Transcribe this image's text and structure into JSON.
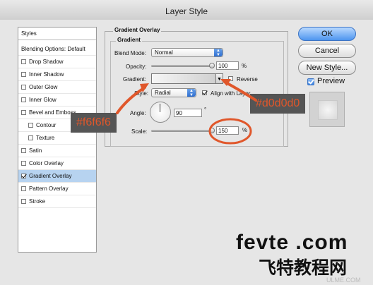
{
  "window": {
    "title": "Layer Style"
  },
  "styles_panel": {
    "items": [
      {
        "label": "Styles",
        "checkbox": false,
        "checked": false,
        "selected": false,
        "indent": 0
      },
      {
        "label": "Blending Options: Default",
        "checkbox": false,
        "checked": false,
        "selected": false,
        "indent": 0
      },
      {
        "label": "Drop Shadow",
        "checkbox": true,
        "checked": false,
        "selected": false,
        "indent": 0
      },
      {
        "label": "Inner Shadow",
        "checkbox": true,
        "checked": false,
        "selected": false,
        "indent": 0
      },
      {
        "label": "Outer Glow",
        "checkbox": true,
        "checked": false,
        "selected": false,
        "indent": 0
      },
      {
        "label": "Inner Glow",
        "checkbox": true,
        "checked": false,
        "selected": false,
        "indent": 0
      },
      {
        "label": "Bevel and Emboss",
        "checkbox": true,
        "checked": false,
        "selected": false,
        "indent": 0
      },
      {
        "label": "Contour",
        "checkbox": true,
        "checked": false,
        "selected": false,
        "indent": 1
      },
      {
        "label": "Texture",
        "checkbox": true,
        "checked": false,
        "selected": false,
        "indent": 1
      },
      {
        "label": "Satin",
        "checkbox": true,
        "checked": false,
        "selected": false,
        "indent": 0
      },
      {
        "label": "Color Overlay",
        "checkbox": true,
        "checked": false,
        "selected": false,
        "indent": 0
      },
      {
        "label": "Gradient Overlay",
        "checkbox": true,
        "checked": true,
        "selected": true,
        "indent": 0
      },
      {
        "label": "Pattern Overlay",
        "checkbox": true,
        "checked": false,
        "selected": false,
        "indent": 0
      },
      {
        "label": "Stroke",
        "checkbox": true,
        "checked": false,
        "selected": false,
        "indent": 0
      }
    ]
  },
  "gradient_overlay": {
    "section_title": "Gradient Overlay",
    "group_title": "Gradient",
    "blend_mode": {
      "label": "Blend Mode:",
      "value": "Normal"
    },
    "opacity": {
      "label": "Opacity:",
      "value": "100",
      "unit": "%",
      "level": 100
    },
    "gradient": {
      "label": "Gradient:",
      "start_color": "#f6f6f6",
      "end_color": "#d0d0d0"
    },
    "reverse": {
      "label": "Reverse",
      "checked": false
    },
    "style": {
      "label": "Style:",
      "value": "Radial"
    },
    "align_with_layer": {
      "label": "Align with Layer",
      "checked": true
    },
    "angle": {
      "label": "Angle:",
      "value": "90",
      "unit": "°"
    },
    "scale": {
      "label": "Scale:",
      "value": "150",
      "unit": "%",
      "level": 100
    }
  },
  "buttons": {
    "ok": "OK",
    "cancel": "Cancel",
    "new_style": "New Style..."
  },
  "preview": {
    "label": "Preview",
    "checked": true
  },
  "annotations": {
    "left": "#f6f6f6",
    "right": "#d0d0d0",
    "color": "#e0572b"
  },
  "watermark": {
    "line1": "fevte .com",
    "line2": "飞特教程网",
    "small": "ULME.COM"
  },
  "colors": {
    "accent_blue": "#2e6fd2",
    "selection": "#b7d3f0",
    "callout_bg": "#555555",
    "annotation": "#e0572b"
  }
}
